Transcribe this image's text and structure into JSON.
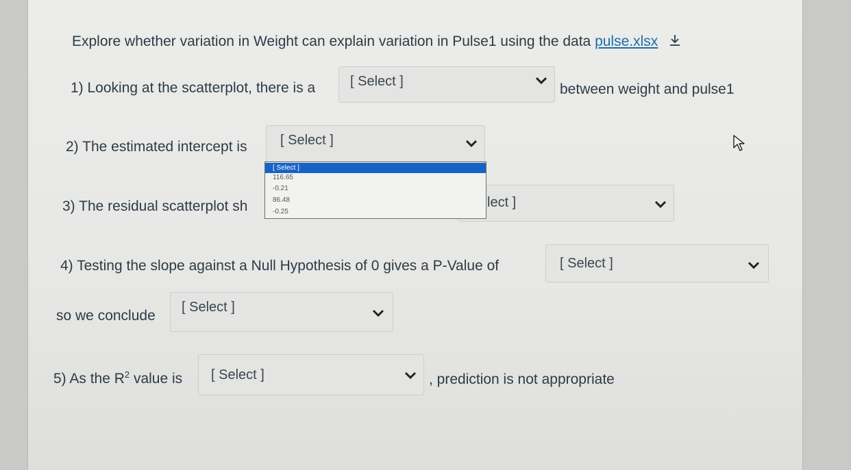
{
  "intro": {
    "text": "Explore whether variation in Weight can explain variation in Pulse1 using the data",
    "link": "pulse.xlsx"
  },
  "q1": {
    "prefix": "1) Looking at the scatterplot, there is a",
    "select": "[ Select ]",
    "suffix": "between weight and pulse1"
  },
  "q2": {
    "prefix": "2) The estimated intercept is",
    "select": "[ Select ]",
    "options": [
      "[ Select ]",
      "116.65",
      "-0.21",
      "86.48",
      "-0.25"
    ]
  },
  "q3": {
    "prefix": "3) The residual scatterplot sh",
    "select_partial": "lect ]"
  },
  "q4": {
    "prefix": "4) Testing the slope against a Null Hypothesis of 0 gives a P-Value of",
    "select": "[ Select ]",
    "conclude_prefix": "so we conclude",
    "conclude_select": "[ Select ]"
  },
  "q5": {
    "prefix": "5) As the R",
    "superscript": "2",
    "prefix_end": " value is",
    "select": "[ Select ]",
    "suffix": ", prediction is not appropriate"
  },
  "icons": {
    "download": "download-icon",
    "chevron": "chevron-down-icon",
    "cursor": "mouse-pointer-icon"
  }
}
